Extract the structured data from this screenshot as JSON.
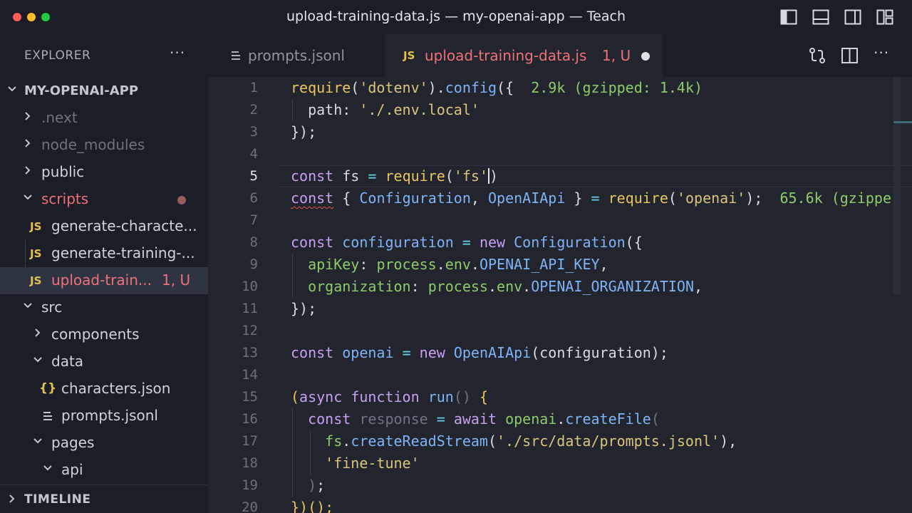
{
  "window": {
    "title": "upload-training-data.js — my-openai-app — Teach"
  },
  "explorer": {
    "label": "EXPLORER",
    "more": "···",
    "root": "MY-OPENAI-APP",
    "items": [
      {
        "label": ".next"
      },
      {
        "label": "node_modules"
      },
      {
        "label": "public"
      },
      {
        "label": "scripts"
      },
      {
        "label": "generate-characte...",
        "badge": "JS"
      },
      {
        "label": "generate-training-...",
        "badge": "JS"
      },
      {
        "label": "upload-train...",
        "badge": "JS",
        "status": "1, U"
      },
      {
        "label": "src"
      },
      {
        "label": "components"
      },
      {
        "label": "data"
      },
      {
        "label": "characters.json",
        "badge": "{}"
      },
      {
        "label": "prompts.jsonl"
      },
      {
        "label": "pages"
      },
      {
        "label": "api"
      }
    ],
    "timeline": "TIMELINE"
  },
  "tabs": [
    {
      "label": "prompts.jsonl",
      "icon": "lines-icon"
    },
    {
      "label": "upload-training-data.js",
      "icon": "JS",
      "status": "1, U"
    }
  ],
  "editor": {
    "active_line": 5,
    "line_numbers": [
      "1",
      "2",
      "3",
      "4",
      "5",
      "6",
      "7",
      "8",
      "9",
      "10",
      "11",
      "12",
      "13",
      "14",
      "15",
      "16",
      "17",
      "18",
      "19",
      "20"
    ],
    "hints": {
      "line1": "2.9k (gzipped: 1.4k)",
      "line6": "65.6k (gzippe"
    }
  },
  "colors": {
    "accent_red": "#f0707a",
    "js_yellow": "#e3c14e",
    "background": "#22252e",
    "sidebar": "#1b1e26"
  }
}
